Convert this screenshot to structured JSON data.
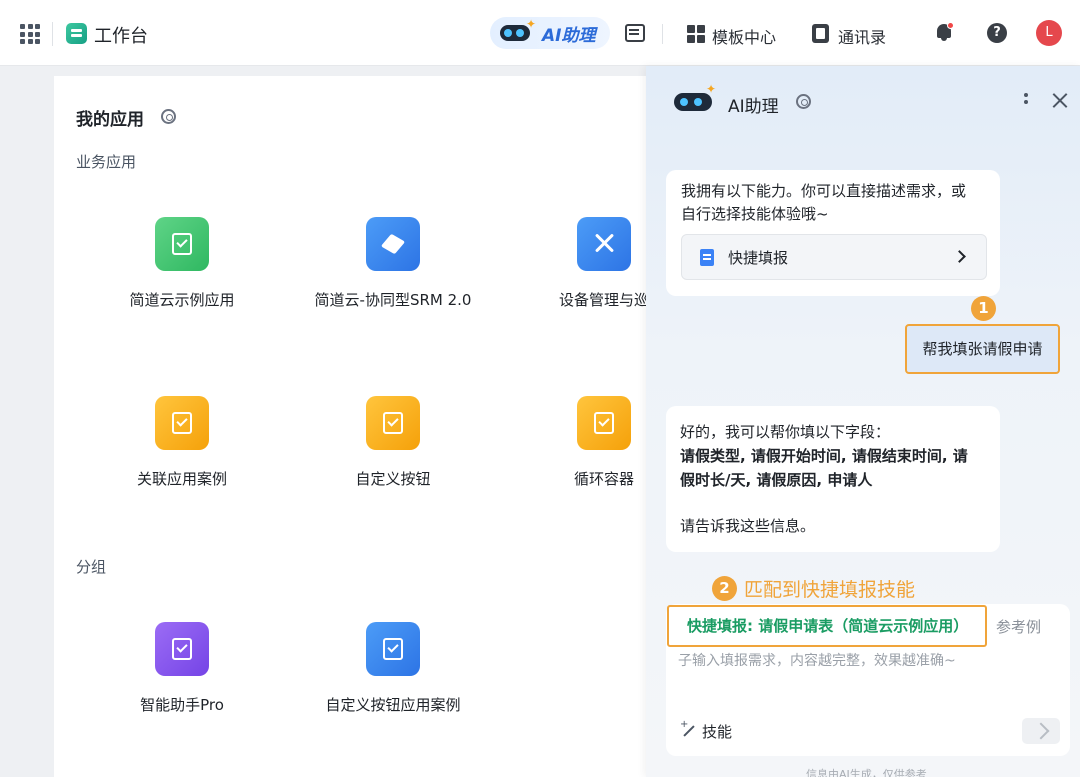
{
  "topbar": {
    "title": "工作台",
    "ai_label": "AI助理",
    "template_label": "模板中心",
    "contacts_label": "通讯录",
    "help_label": "?",
    "avatar_initial": "L"
  },
  "main": {
    "my_apps_title": "我的应用",
    "business_section": "业务应用",
    "group_section": "分组",
    "business_apps": [
      {
        "name": "简道云示例应用",
        "color": "green"
      },
      {
        "name": "简道云-协同型SRM 2.0",
        "color": "blue"
      },
      {
        "name": "设备管理与巡",
        "color": "blue"
      },
      {
        "name": "关联应用案例",
        "color": "orange"
      },
      {
        "name": "自定义按钮",
        "color": "orange"
      },
      {
        "name": "循环容器",
        "color": "orange"
      }
    ],
    "group_apps": [
      {
        "name": "智能助手Pro",
        "color": "purple"
      },
      {
        "name": "自定义按钮应用案例",
        "color": "blue"
      }
    ]
  },
  "ai_panel": {
    "title": "AI助理",
    "intro_line1": "我拥有以下能力。你可以直接描述需求，或",
    "intro_line2": "自行选择技能体验哦~",
    "skill_option": "快捷填报",
    "step1_badge": "1",
    "user_message": "帮我填张请假申请",
    "reply_line1": "好的，我可以帮你填以下字段：",
    "reply_fields_line1": "请假类型, 请假开始时间, 请假结束时间, 请",
    "reply_fields_line2": "假时长/天, 请假原因, 申请人",
    "reply_ask": "请告诉我这些信息。",
    "step2_badge": "2",
    "match_note": "匹配到快捷填报技能",
    "match_pill": "快捷填报: 请假申请表（简道云示例应用）",
    "ref_text": "参考例",
    "input_placeholder": "子输入填报需求，内容越完整，效果越准确~",
    "skill_button": "技能",
    "disclaimer": "信息由AI生成，仅供参考"
  },
  "colors": {
    "accent_orange": "#f0a43a",
    "brand_blue": "#2c6bd8",
    "match_green": "#1a9c63"
  }
}
